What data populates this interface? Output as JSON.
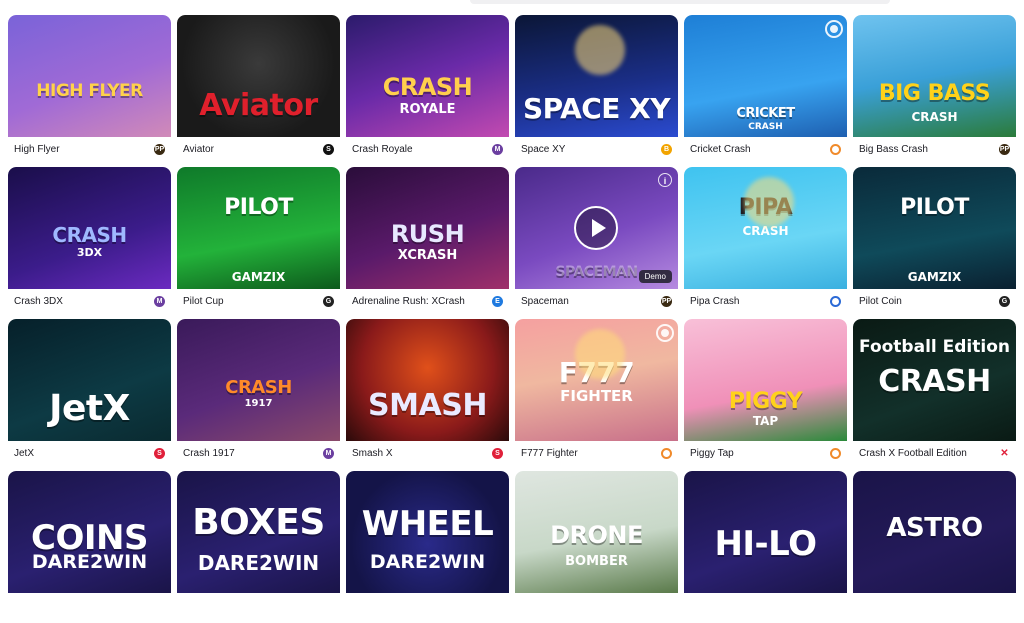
{
  "games": [
    {
      "name": "High Flyer",
      "provider_icon": "pragmatic-play-icon",
      "provider_mark": "PP",
      "provider_color": "#3a2a12",
      "thumb_text": "HIGH FLYER",
      "thumb_sub": "",
      "bg": "linear-gradient(160deg,#7a63d8 0%,#a06ad6 55%,#d18ab8 100%)",
      "title_color": "#ffd24a"
    },
    {
      "name": "Aviator",
      "provider_icon": "spribe-icon",
      "provider_mark": "S",
      "provider_color": "#111111",
      "thumb_text": "Aviator",
      "thumb_sub": "",
      "bg": "radial-gradient(circle at 50% 40%,#3a3a3a 0%,#1a1a1a 70%)",
      "title_color": "#e0202c"
    },
    {
      "name": "Crash Royale",
      "provider_icon": "one-m-icon",
      "provider_mark": "M",
      "provider_color": "#6b3fa0",
      "thumb_text": "CRASH",
      "thumb_sub": "ROYALE",
      "bg": "linear-gradient(160deg,#2b1b6b 0%,#6a2aa8 50%,#c24ab0 100%)",
      "title_color": "#ffcf4d"
    },
    {
      "name": "Space XY",
      "provider_icon": "bgaming-icon",
      "provider_mark": "B",
      "provider_color": "#f2a400",
      "thumb_text": "SPACE XY",
      "thumb_sub": "",
      "bg": "linear-gradient(170deg,#0b1636 0%,#1b2f8a 60%,#2b4bd0 100%)",
      "title_color": "#ffffff"
    },
    {
      "name": "Cricket Crash",
      "provider_icon": "circle-provider-icon",
      "provider_mark": "",
      "provider_color": "#f08a2a",
      "thumb_text": "CRICKET",
      "thumb_sub": "CRASH",
      "bg": "linear-gradient(170deg,#1e7fd6 0%,#38a3f0 60%,#1e5fb0 100%)",
      "title_color": "#ffffff"
    },
    {
      "name": "Big Bass Crash",
      "provider_icon": "pragmatic-play-icon",
      "provider_mark": "PP",
      "provider_color": "#3a2a12",
      "thumb_text": "BIG BASS",
      "thumb_sub": "CRASH",
      "bg": "linear-gradient(170deg,#6fc3ef 0%,#3aa0d8 50%,#2b7b3a 100%)",
      "title_color": "#ffd21a"
    },
    {
      "name": "Crash 3DX",
      "provider_icon": "one-m-icon",
      "provider_mark": "M",
      "provider_color": "#6b3fa0",
      "thumb_text": "CRASH",
      "thumb_sub": "3DX",
      "bg": "linear-gradient(160deg,#1a0e4a 0%,#3b1c8a 60%,#6b2ac0 100%)",
      "title_color": "#9fb8ff"
    },
    {
      "name": "Pilot Cup",
      "provider_icon": "gamzix-icon",
      "provider_mark": "G",
      "provider_color": "#222222",
      "thumb_text": "PILOT",
      "thumb_sub": "GAMZIX",
      "bg": "linear-gradient(170deg,#0f7a2a 0%,#23b23a 60%,#0d5a1c 100%)",
      "title_color": "#ffffff"
    },
    {
      "name": "Adrenaline Rush: XCrash",
      "provider_icon": "evoplay-icon",
      "provider_mark": "E",
      "provider_color": "#1f7ae0",
      "thumb_text": "RUSH",
      "thumb_sub": "XCRASH",
      "bg": "linear-gradient(160deg,#2a0d3a 0%,#5a1a6a 55%,#a0306a 100%)",
      "title_color": "#e8e8ff"
    },
    {
      "name": "Spaceman",
      "provider_icon": "pragmatic-play-icon",
      "provider_mark": "PP",
      "provider_color": "#3a2a12",
      "thumb_text": "SPACEMAN",
      "thumb_sub": "",
      "bg": "linear-gradient(160deg,#4a2a8a 0%,#7a4ac0 55%,#b58ae0 100%)",
      "title_color": "rgba(255,255,255,0.35)",
      "demo_label": "Demo"
    },
    {
      "name": "Pipa Crash",
      "provider_icon": "shield-provider-icon",
      "provider_mark": "",
      "provider_color": "#2b6ad6",
      "thumb_text": "PIPA",
      "thumb_sub": "CRASH",
      "bg": "linear-gradient(170deg,#3fc3f0 0%,#6ad6f5 60%,#3ab0e0 100%)",
      "title_color": "#1b1b22"
    },
    {
      "name": "Pilot Coin",
      "provider_icon": "gamzix-icon",
      "provider_mark": "G",
      "provider_color": "#222222",
      "thumb_text": "PILOT",
      "thumb_sub": "GAMZIX",
      "bg": "linear-gradient(170deg,#0a2a3a 0%,#0f4a5a 60%,#0a2030 100%)",
      "title_color": "#ffffff"
    },
    {
      "name": "JetX",
      "provider_icon": "smartsoft-icon",
      "provider_mark": "S",
      "provider_color": "#e0203a",
      "thumb_text": "JetX",
      "thumb_sub": "",
      "bg": "linear-gradient(160deg,#06202a 0%,#0d3a44 60%,#0a2a30 100%)",
      "title_color": "#ffffff"
    },
    {
      "name": "Crash 1917",
      "provider_icon": "one-m-icon",
      "provider_mark": "M",
      "provider_color": "#6b3fa0",
      "thumb_text": "CRASH",
      "thumb_sub": "1917",
      "bg": "linear-gradient(160deg,#3a1a5a 0%,#5a2a7a 55%,#8a4a6a 100%)",
      "title_color": "#ff8a2a"
    },
    {
      "name": "Smash X",
      "provider_icon": "smartsoft-icon",
      "provider_mark": "S",
      "provider_color": "#e0203a",
      "thumb_text": "SMASH",
      "thumb_sub": "",
      "bg": "radial-gradient(circle at 50% 40%,#e0501a 0%,#8a1a1a 60%,#2a0a0a 100%)",
      "title_color": "#eaeaff"
    },
    {
      "name": "F777 Fighter",
      "provider_icon": "circle-provider-icon",
      "provider_mark": "",
      "provider_color": "#f08a2a",
      "thumb_text": "F777",
      "thumb_sub": "FIGHTER",
      "bg": "linear-gradient(170deg,#f5a0a0 0%,#f0b8a0 45%,#c8708a 100%)",
      "title_color": "#ffffff"
    },
    {
      "name": "Piggy Tap",
      "provider_icon": "circle-provider-icon",
      "provider_mark": "",
      "provider_color": "#f08a2a",
      "thumb_text": "PIGGY",
      "thumb_sub": "TAP",
      "bg": "linear-gradient(170deg,#f8c0d8 0%,#f090b8 60%,#2a8a3a 100%)",
      "title_color": "#ffd21a"
    },
    {
      "name": "Crash X Football Edition",
      "provider_icon": "x-provider-icon",
      "provider_mark": "✕",
      "provider_color": "#ffffff",
      "thumb_text": "CRASH",
      "thumb_sub": "Football Edition",
      "bg": "linear-gradient(160deg,#0a1a14 0%,#12302a 60%,#0a1a14 100%)",
      "title_color": "#ffffff"
    },
    {
      "name": "",
      "provider_icon": "",
      "provider_mark": "",
      "provider_color": "#ffffff",
      "thumb_text": "COINS",
      "thumb_sub": "DARE2WIN",
      "bg": "linear-gradient(160deg,#1a1448 0%,#2a2070 60%,#1a1448 100%)",
      "title_color": "#ffffff"
    },
    {
      "name": "",
      "provider_icon": "",
      "provider_mark": "",
      "provider_color": "#ffffff",
      "thumb_text": "BOXES",
      "thumb_sub": "DARE2WIN",
      "bg": "linear-gradient(160deg,#1a1448 0%,#2a2070 60%,#1a1448 100%)",
      "title_color": "#ffffff"
    },
    {
      "name": "",
      "provider_icon": "",
      "provider_mark": "",
      "provider_color": "#ffffff",
      "thumb_text": "WHEEL",
      "thumb_sub": "DARE2WIN",
      "bg": "radial-gradient(circle at 50% 60%,#2a2a8a 0%,#141448 70%)",
      "title_color": "#ffffff"
    },
    {
      "name": "",
      "provider_icon": "",
      "provider_mark": "",
      "provider_color": "#ffffff",
      "thumb_text": "DRONE",
      "thumb_sub": "BOMBER",
      "bg": "linear-gradient(170deg,#dfe6e0 0%,#c8d8c8 55%,#5a7a4a 100%)",
      "title_color": "#ffffff"
    },
    {
      "name": "",
      "provider_icon": "",
      "provider_mark": "",
      "provider_color": "#ffffff",
      "thumb_text": "HI-LO",
      "thumb_sub": "",
      "bg": "linear-gradient(160deg,#1a1448 0%,#2a2070 60%,#1a1448 100%)",
      "title_color": "#ffffff"
    },
    {
      "name": "",
      "provider_icon": "",
      "provider_mark": "",
      "provider_color": "#ffffff",
      "thumb_text": "ASTRO",
      "thumb_sub": "",
      "bg": "linear-gradient(160deg,#1a1448 0%,#241a5a 60%,#1a1448 100%)",
      "title_color": "#ffffff"
    }
  ]
}
